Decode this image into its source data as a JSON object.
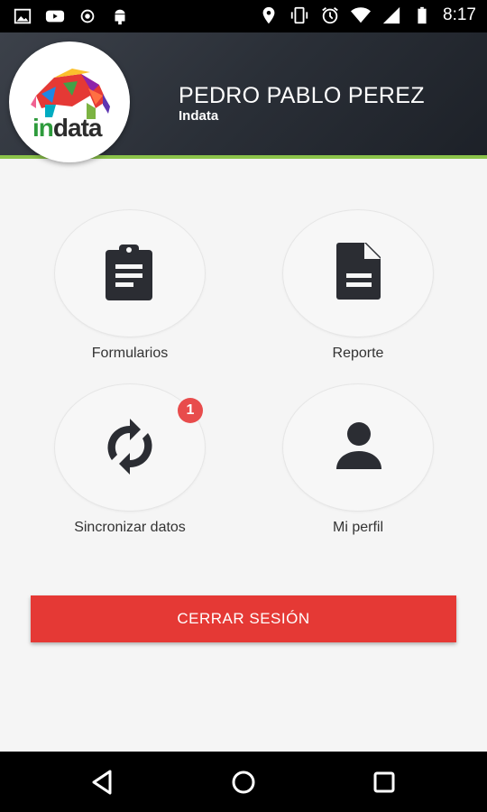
{
  "status_bar": {
    "time": "8:17",
    "left_icons": [
      "image-icon",
      "youtube-icon",
      "location-target-icon",
      "android-icon"
    ],
    "right_icons": [
      "location-pin-icon",
      "vibrate-icon",
      "alarm-icon",
      "wifi-icon",
      "signal-icon",
      "battery-icon"
    ]
  },
  "header": {
    "user_name": "PEDRO PABLO PEREZ",
    "organization": "Indata",
    "logo": {
      "word_in": "in",
      "word_data": "data"
    },
    "accent_color": "#8bc34a"
  },
  "menu": [
    {
      "label": "Formularios",
      "icon": "clipboard-icon"
    },
    {
      "label": "Reporte",
      "icon": "document-icon"
    },
    {
      "label": "Sincronizar datos",
      "icon": "sync-icon",
      "badge": "1"
    },
    {
      "label": "Mi perfil",
      "icon": "person-icon"
    }
  ],
  "logout_button": {
    "label": "CERRAR SESIÓN",
    "color": "#e53935"
  },
  "nav_bar": [
    "back-icon",
    "home-icon",
    "recents-icon"
  ]
}
